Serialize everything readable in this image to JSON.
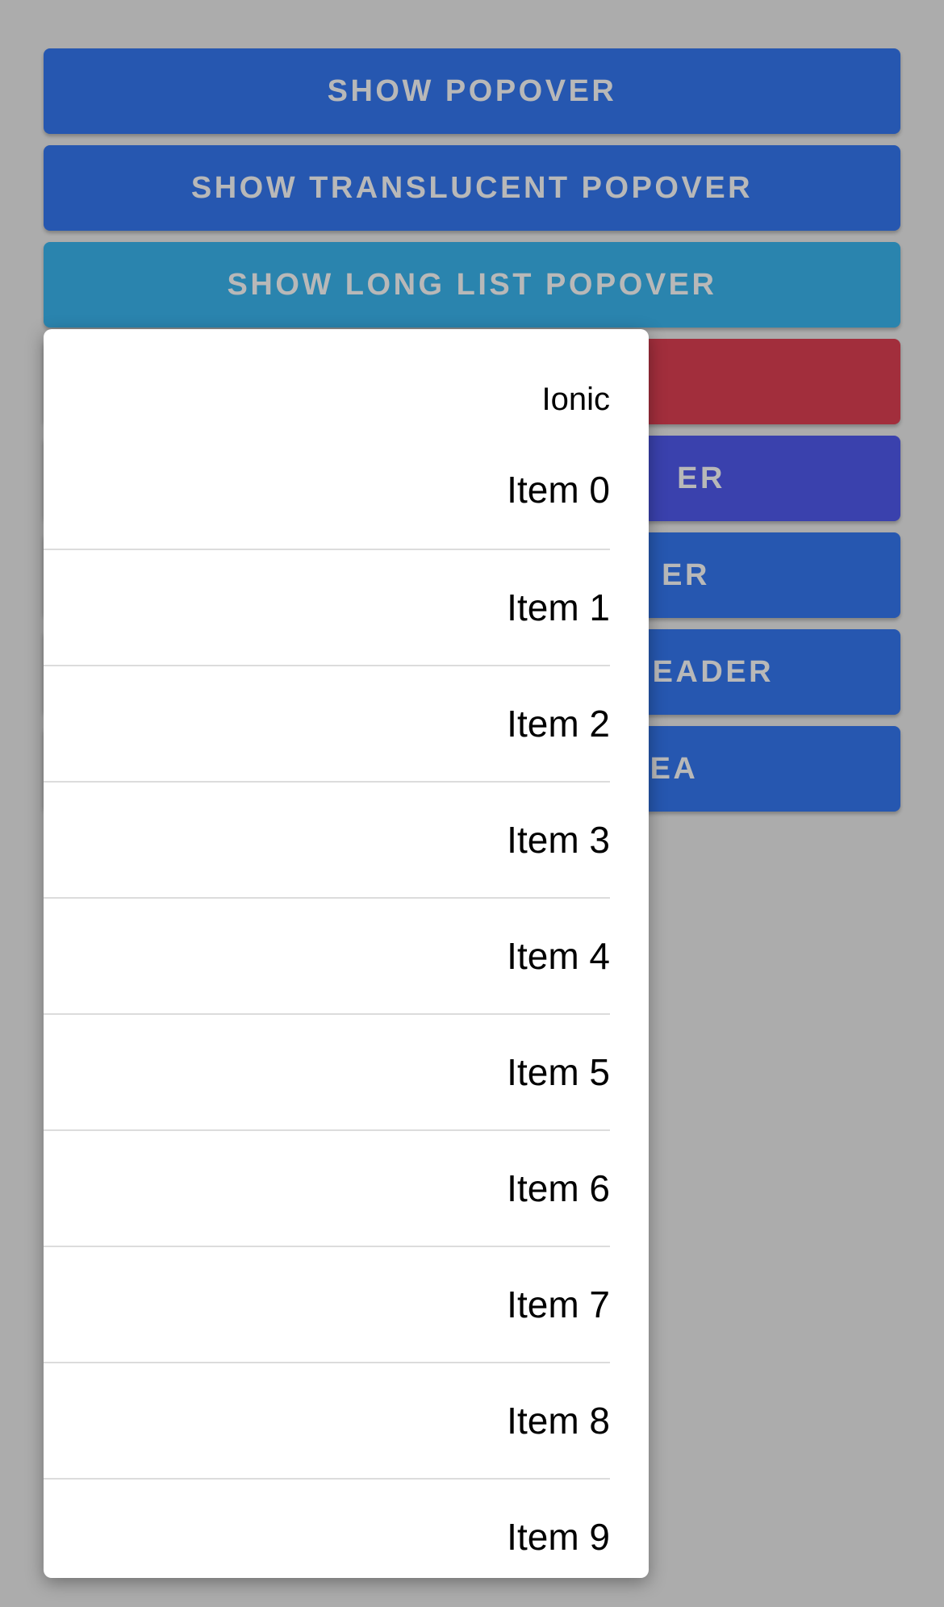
{
  "buttons": [
    {
      "label": "SHOW POPOVER",
      "color": "#2657b0"
    },
    {
      "label": "SHOW TRANSLUCENT POPOVER",
      "color": "#2657b0"
    },
    {
      "label": "SHOW LONG LIST POPOVER",
      "color": "#2a84ae"
    },
    {
      "label": "",
      "color": "#a22e3c"
    },
    {
      "label": "ER",
      "color": "#3a41ad"
    },
    {
      "label": "ER",
      "color": "#2657b0"
    },
    {
      "label": "T HEADER",
      "color": "#2657b0"
    },
    {
      "label": "REA",
      "color": "#2657b0"
    }
  ],
  "popover": {
    "header": "Ionic",
    "items": [
      "Item 0",
      "Item 1",
      "Item 2",
      "Item 3",
      "Item 4",
      "Item 5",
      "Item 6",
      "Item 7",
      "Item 8",
      "Item 9"
    ]
  },
  "colors": {
    "backdrop": "#acacac",
    "popover_bg": "#ffffff",
    "divider": "#dcdcdc"
  }
}
